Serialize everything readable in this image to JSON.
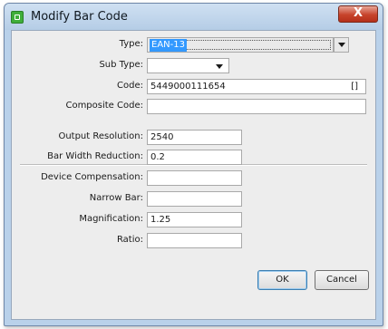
{
  "window": {
    "title": "Modify Bar Code",
    "close_label": "X"
  },
  "form": {
    "type": {
      "label": "Type:",
      "value": "EAN-13"
    },
    "subtype": {
      "label": "Sub Type:",
      "value": ""
    },
    "code": {
      "label": "Code:",
      "value": "5449000111654",
      "bracket": "[]"
    },
    "composite": {
      "label": "Composite Code:",
      "value": ""
    },
    "output_resolution": {
      "label": "Output Resolution:",
      "value": "2540"
    },
    "bar_width_reduction": {
      "label": "Bar Width Reduction:",
      "value": "0.2"
    },
    "device_compensation": {
      "label": "Device Compensation:",
      "value": ""
    },
    "narrow_bar": {
      "label": "Narrow Bar:",
      "value": ""
    },
    "magnification": {
      "label": "Magnification:",
      "value": "1.25"
    },
    "ratio": {
      "label": "Ratio:",
      "value": ""
    }
  },
  "buttons": {
    "ok": "OK",
    "cancel": "Cancel"
  }
}
